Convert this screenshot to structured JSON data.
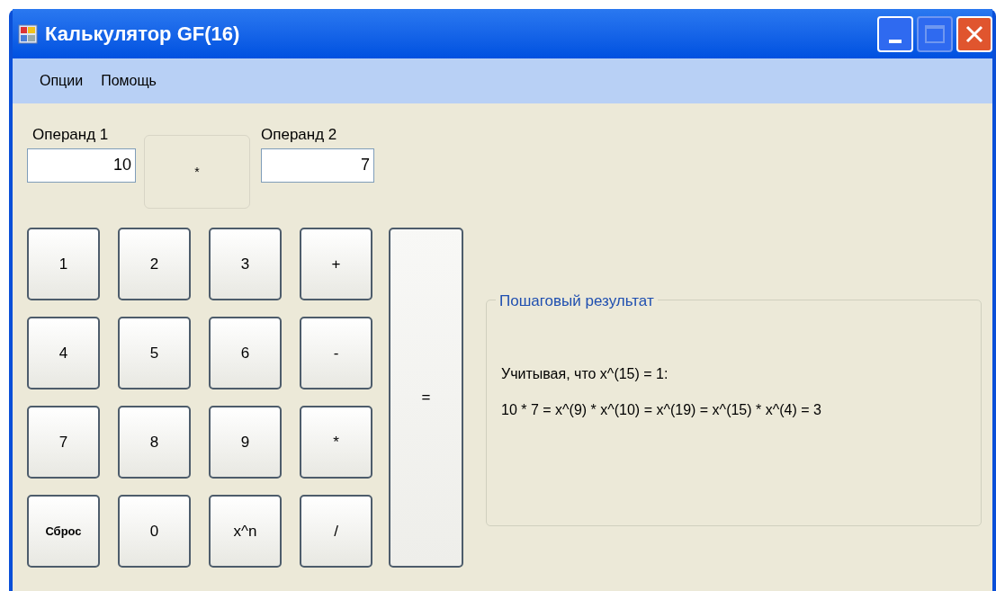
{
  "window": {
    "title": "Калькулятор GF(16)"
  },
  "menu": [
    "Опции",
    "Помощь"
  ],
  "operand1": {
    "label": "Операнд 1",
    "value": "10"
  },
  "operation": {
    "symbol": "*"
  },
  "operand2": {
    "label": "Операнд 2",
    "value": "7"
  },
  "keys": [
    {
      "label": "1"
    },
    {
      "label": "2"
    },
    {
      "label": "3"
    },
    {
      "label": "+"
    },
    {
      "label": "4"
    },
    {
      "label": "5"
    },
    {
      "label": "6"
    },
    {
      "label": "-"
    },
    {
      "label": "7"
    },
    {
      "label": "8"
    },
    {
      "label": "9"
    },
    {
      "label": "*"
    },
    {
      "label": "Сброс",
      "kind": "small"
    },
    {
      "label": "0"
    },
    {
      "label": "x^n"
    },
    {
      "label": "/"
    }
  ],
  "equals": {
    "label": "="
  },
  "result": {
    "title": "Пошаговый результат",
    "lines": [
      "Учитывая, что x^(15) = 1:",
      "10 * 7 = x^(9) * x^(10) = x^(19) = x^(15) * x^(4) = 3"
    ]
  }
}
